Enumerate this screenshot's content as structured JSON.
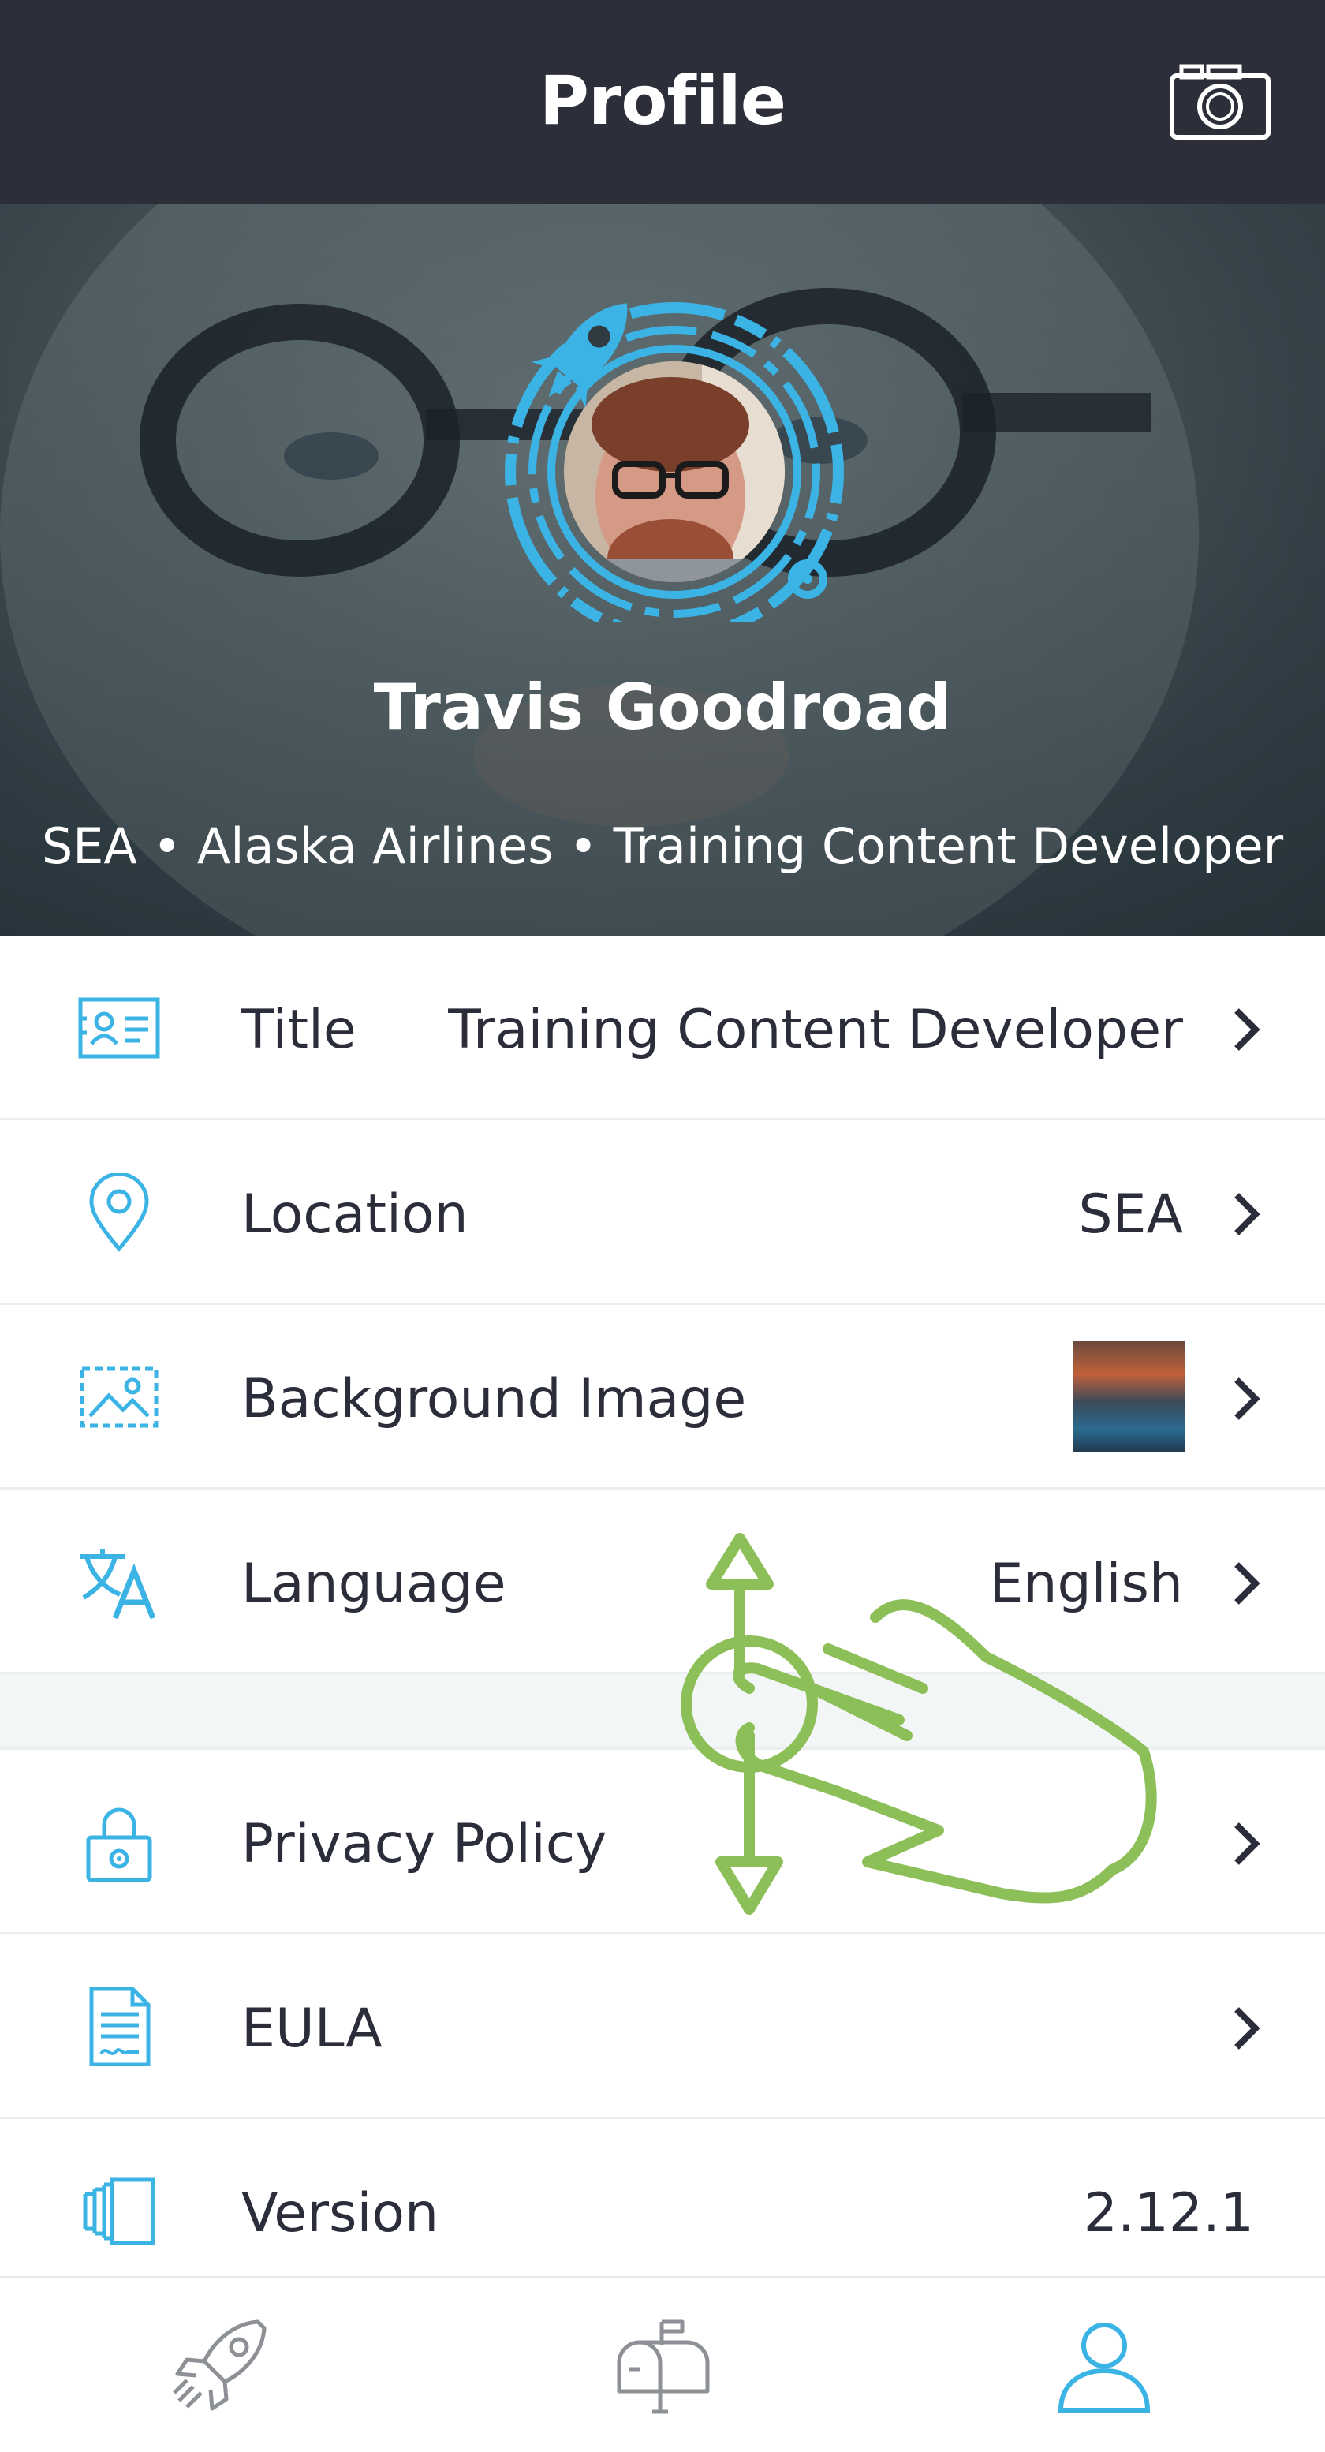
{
  "header": {
    "title": "Profile",
    "camera_icon": "camera-icon"
  },
  "profile": {
    "name": "Travis Goodroad",
    "subtitle": "SEA • Alaska Airlines • Training Content Developer",
    "avatar_icon": "rocket-badge-avatar"
  },
  "settings": {
    "title": {
      "label": "Title",
      "value": "Training Content Developer",
      "icon": "id-card-icon"
    },
    "location": {
      "label": "Location",
      "value": "SEA",
      "icon": "map-pin-icon"
    },
    "background_image": {
      "label": "Background Image",
      "icon": "image-icon"
    },
    "language": {
      "label": "Language",
      "value": "English",
      "icon": "translate-icon"
    },
    "privacy": {
      "label": "Privacy Policy",
      "icon": "lock-icon"
    },
    "eula": {
      "label": "EULA",
      "icon": "document-icon"
    },
    "version": {
      "label": "Version",
      "value": "2.12.1",
      "icon": "versions-icon"
    }
  },
  "tabbar": {
    "items": [
      "rocket-icon",
      "mailbox-icon",
      "profile-icon"
    ],
    "active": "profile-icon"
  },
  "colors": {
    "header_bg": "#2c2f39",
    "accent": "#3bb4e5",
    "gesture": "#8cbf58",
    "text": "#2b2d3a"
  }
}
